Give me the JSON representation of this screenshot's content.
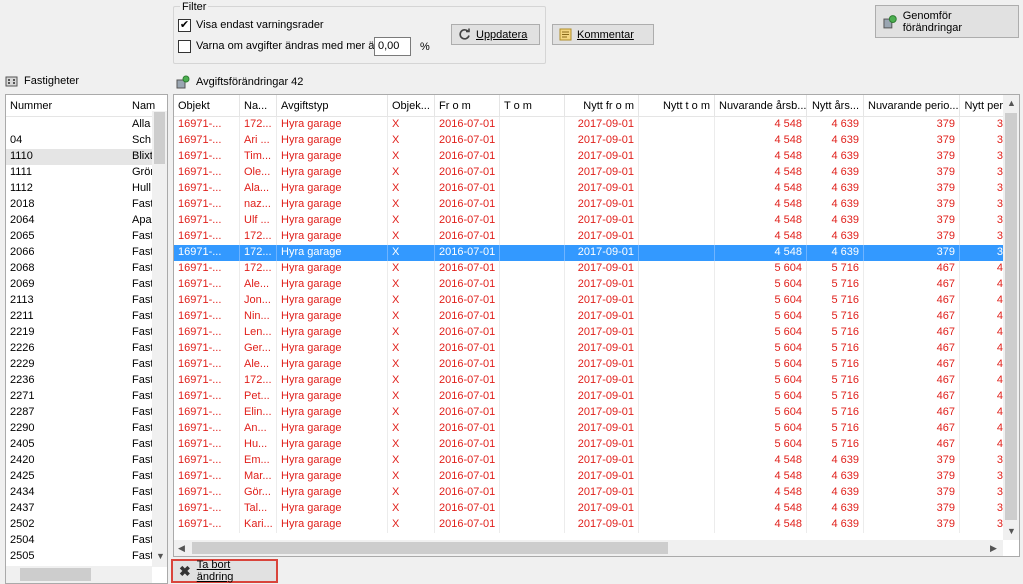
{
  "filter": {
    "legend": "Filter",
    "show_warnings_label": "Visa endast varningsrader",
    "show_warnings_checked": true,
    "warn_change_label": "Varna om avgifter ändras med mer än",
    "warn_change_checked": false,
    "percent_value": "0,00",
    "percent_sign": "%",
    "update_label": "Uppdatera",
    "comment_label": "Kommentar"
  },
  "commit_label": "Genomför förändringar",
  "left_panel": {
    "title": "Fastigheter",
    "columns": [
      "Nummer",
      "Nam"
    ],
    "rows": [
      [
        "",
        "Alla"
      ],
      [
        "04",
        "Sch"
      ],
      [
        "1110",
        "Blixt"
      ],
      [
        "1111",
        "Grön"
      ],
      [
        "1112",
        "Hull"
      ],
      [
        "2018",
        "Fast"
      ],
      [
        "2064",
        "Apa"
      ],
      [
        "2065",
        "Fast"
      ],
      [
        "2066",
        "Fast"
      ],
      [
        "2068",
        "Fast"
      ],
      [
        "2069",
        "Fast"
      ],
      [
        "2113",
        "Fast"
      ],
      [
        "2211",
        "Fast"
      ],
      [
        "2219",
        "Fast"
      ],
      [
        "2226",
        "Fast"
      ],
      [
        "2229",
        "Fast"
      ],
      [
        "2236",
        "Fast"
      ],
      [
        "2271",
        "Fast"
      ],
      [
        "2287",
        "Fast"
      ],
      [
        "2290",
        "Fast"
      ],
      [
        "2405",
        "Fast"
      ],
      [
        "2420",
        "Fast"
      ],
      [
        "2425",
        "Fast"
      ],
      [
        "2434",
        "Fast"
      ],
      [
        "2437",
        "Fast"
      ],
      [
        "2502",
        "Fast"
      ],
      [
        "2504",
        "Fast"
      ],
      [
        "2505",
        "Fast"
      ]
    ],
    "selected_index": 2
  },
  "main_panel": {
    "title": "Avgiftsförändringar 42",
    "columns": [
      "Objekt",
      "Na...",
      "Avgiftstyp",
      "Objek...",
      "Fr o m",
      "T o m",
      "Nytt fr o m",
      "Nytt t o m",
      "Nuvarande årsb...",
      "Nytt års...",
      "Nuvarande perio...",
      "Nytt per"
    ],
    "rows": [
      [
        "16971-...",
        "172...",
        "Hyra garage",
        "X",
        "2016-07-01",
        "",
        "2017-09-01",
        "",
        "4 548",
        "4 639",
        "379",
        "3"
      ],
      [
        "16971-...",
        "Ari ...",
        "Hyra garage",
        "X",
        "2016-07-01",
        "",
        "2017-09-01",
        "",
        "4 548",
        "4 639",
        "379",
        "3"
      ],
      [
        "16971-...",
        "Tim...",
        "Hyra garage",
        "X",
        "2016-07-01",
        "",
        "2017-09-01",
        "",
        "4 548",
        "4 639",
        "379",
        "3"
      ],
      [
        "16971-...",
        "Ole...",
        "Hyra garage",
        "X",
        "2016-07-01",
        "",
        "2017-09-01",
        "",
        "4 548",
        "4 639",
        "379",
        "3"
      ],
      [
        "16971-...",
        "Ala...",
        "Hyra garage",
        "X",
        "2016-07-01",
        "",
        "2017-09-01",
        "",
        "4 548",
        "4 639",
        "379",
        "3"
      ],
      [
        "16971-...",
        "naz...",
        "Hyra garage",
        "X",
        "2016-07-01",
        "",
        "2017-09-01",
        "",
        "4 548",
        "4 639",
        "379",
        "3"
      ],
      [
        "16971-...",
        "Ulf ...",
        "Hyra garage",
        "X",
        "2016-07-01",
        "",
        "2017-09-01",
        "",
        "4 548",
        "4 639",
        "379",
        "3"
      ],
      [
        "16971-...",
        "172...",
        "Hyra garage",
        "X",
        "2016-07-01",
        "",
        "2017-09-01",
        "",
        "4 548",
        "4 639",
        "379",
        "3"
      ],
      [
        "16971-...",
        "172...",
        "Hyra garage",
        "X",
        "2016-07-01",
        "",
        "2017-09-01",
        "",
        "4 548",
        "4 639",
        "379",
        "3"
      ],
      [
        "16971-...",
        "172...",
        "Hyra garage",
        "X",
        "2016-07-01",
        "",
        "2017-09-01",
        "",
        "5 604",
        "5 716",
        "467",
        "4"
      ],
      [
        "16971-...",
        "Ale...",
        "Hyra garage",
        "X",
        "2016-07-01",
        "",
        "2017-09-01",
        "",
        "5 604",
        "5 716",
        "467",
        "4"
      ],
      [
        "16971-...",
        "Jon...",
        "Hyra garage",
        "X",
        "2016-07-01",
        "",
        "2017-09-01",
        "",
        "5 604",
        "5 716",
        "467",
        "4"
      ],
      [
        "16971-...",
        "Nin...",
        "Hyra garage",
        "X",
        "2016-07-01",
        "",
        "2017-09-01",
        "",
        "5 604",
        "5 716",
        "467",
        "4"
      ],
      [
        "16971-...",
        "Len...",
        "Hyra garage",
        "X",
        "2016-07-01",
        "",
        "2017-09-01",
        "",
        "5 604",
        "5 716",
        "467",
        "4"
      ],
      [
        "16971-...",
        "Ger...",
        "Hyra garage",
        "X",
        "2016-07-01",
        "",
        "2017-09-01",
        "",
        "5 604",
        "5 716",
        "467",
        "4"
      ],
      [
        "16971-...",
        "Ale...",
        "Hyra garage",
        "X",
        "2016-07-01",
        "",
        "2017-09-01",
        "",
        "5 604",
        "5 716",
        "467",
        "4"
      ],
      [
        "16971-...",
        "172...",
        "Hyra garage",
        "X",
        "2016-07-01",
        "",
        "2017-09-01",
        "",
        "5 604",
        "5 716",
        "467",
        "4"
      ],
      [
        "16971-...",
        "Pet...",
        "Hyra garage",
        "X",
        "2016-07-01",
        "",
        "2017-09-01",
        "",
        "5 604",
        "5 716",
        "467",
        "4"
      ],
      [
        "16971-...",
        "Elin...",
        "Hyra garage",
        "X",
        "2016-07-01",
        "",
        "2017-09-01",
        "",
        "5 604",
        "5 716",
        "467",
        "4"
      ],
      [
        "16971-...",
        "An...",
        "Hyra garage",
        "X",
        "2016-07-01",
        "",
        "2017-09-01",
        "",
        "5 604",
        "5 716",
        "467",
        "4"
      ],
      [
        "16971-...",
        "Hu...",
        "Hyra garage",
        "X",
        "2016-07-01",
        "",
        "2017-09-01",
        "",
        "5 604",
        "5 716",
        "467",
        "4"
      ],
      [
        "16971-...",
        "Em...",
        "Hyra garage",
        "X",
        "2016-07-01",
        "",
        "2017-09-01",
        "",
        "4 548",
        "4 639",
        "379",
        "3"
      ],
      [
        "16971-...",
        "Mar...",
        "Hyra garage",
        "X",
        "2016-07-01",
        "",
        "2017-09-01",
        "",
        "4 548",
        "4 639",
        "379",
        "3"
      ],
      [
        "16971-...",
        "Gör...",
        "Hyra garage",
        "X",
        "2016-07-01",
        "",
        "2017-09-01",
        "",
        "4 548",
        "4 639",
        "379",
        "3"
      ],
      [
        "16971-...",
        "Tal...",
        "Hyra garage",
        "X",
        "2016-07-01",
        "",
        "2017-09-01",
        "",
        "4 548",
        "4 639",
        "379",
        "3"
      ],
      [
        "16971-...",
        "Kari...",
        "Hyra garage",
        "X",
        "2016-07-01",
        "",
        "2017-09-01",
        "",
        "4 548",
        "4 639",
        "379",
        "3"
      ]
    ],
    "selected_index": 8
  },
  "remove_label": "Ta bort ändring",
  "colors": {
    "warning_text": "#e0201b",
    "selection": "#3399ff",
    "highlight_border": "#d9443b"
  }
}
